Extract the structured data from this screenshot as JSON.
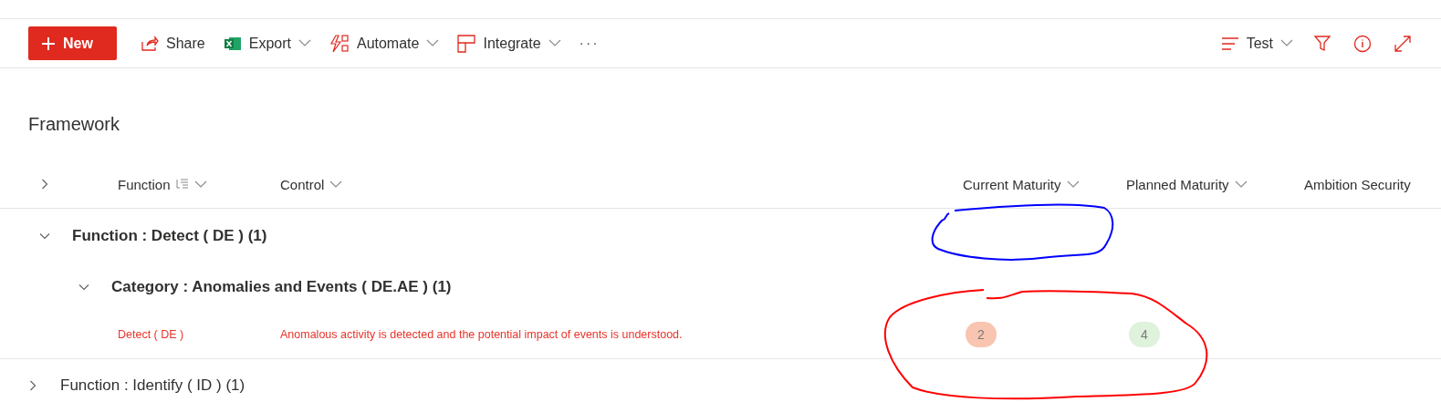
{
  "toolbar": {
    "new_button": "New",
    "items": [
      {
        "kind": "share",
        "label": "Share",
        "caret": false
      },
      {
        "kind": "excel",
        "label": "Export",
        "caret": true
      },
      {
        "kind": "automate",
        "label": "Automate",
        "caret": true
      },
      {
        "kind": "integrate",
        "label": "Integrate",
        "caret": true
      },
      {
        "kind": "more",
        "label": "···",
        "caret": false
      }
    ],
    "view": {
      "label": "Test"
    }
  },
  "list_title": "Framework",
  "table": {
    "expanded": false,
    "columns": [
      {
        "label": "Function",
        "grouped": true
      },
      {
        "label": "Control",
        "grouped": false
      },
      {
        "label": "Current Maturity",
        "grouped": false
      },
      {
        "label": "Planned Maturity",
        "grouped": false
      },
      {
        "label": "Ambition Security",
        "grouped": false
      }
    ],
    "groups": [
      {
        "label": "Function : Detect ( DE ) (1)",
        "expanded": true,
        "children": [
          {
            "label": "Category : Anomalies and Events ( DE.AE ) (1)",
            "expanded": true,
            "rows": [
              {
                "function": "Detect ( DE )",
                "control": "Anomalous activity is detected and the potential impact of events is understood.",
                "current_maturity": {
                  "value": "2",
                  "color": "#f9c4b0"
                },
                "planned_maturity": {
                  "value": "4",
                  "color": "#dff2dc"
                }
              }
            ]
          }
        ]
      },
      {
        "label": "Function : Identify ( ID ) (1)",
        "expanded": false
      }
    ]
  },
  "annotations": [
    {
      "color": "#0000ff"
    },
    {
      "color": "#ff0000"
    }
  ]
}
